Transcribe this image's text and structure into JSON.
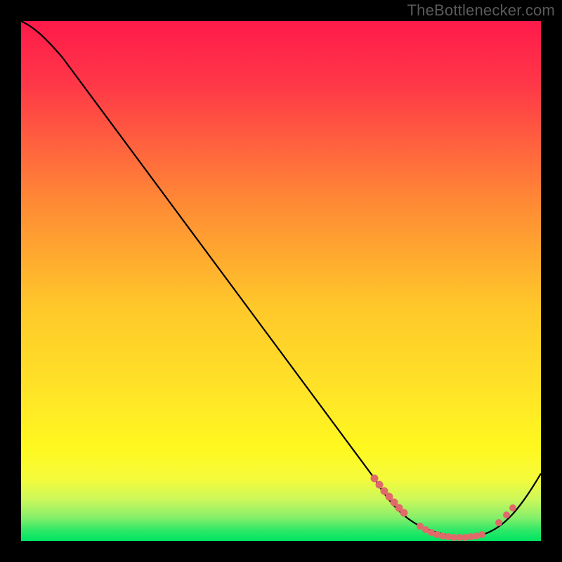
{
  "watermark": "TheBottlenecker.com",
  "chart_data": {
    "type": "line",
    "title": "",
    "xlabel": "",
    "ylabel": "",
    "xlim": [
      0,
      100
    ],
    "ylim": [
      0,
      100
    ],
    "background_gradient": [
      "#ff1a4a",
      "#ffdc28",
      "#00e860"
    ],
    "gradient_stops": [
      0,
      80,
      100
    ],
    "series": [
      {
        "name": "curve",
        "x": [
          0,
          2,
          5,
          8,
          68,
          72,
          77,
          82,
          87,
          90,
          94,
          100
        ],
        "y": [
          100,
          99,
          96.5,
          93,
          12,
          7,
          3,
          1,
          0.5,
          1,
          4,
          13
        ],
        "color": "#000000"
      }
    ],
    "markers": {
      "name": "highlight-dots",
      "color": "#e16b6b",
      "x_ranges": [
        [
          68,
          73
        ],
        [
          77,
          88
        ],
        [
          91,
          94
        ]
      ],
      "y_approx": [
        10,
        1.5,
        5
      ]
    }
  }
}
